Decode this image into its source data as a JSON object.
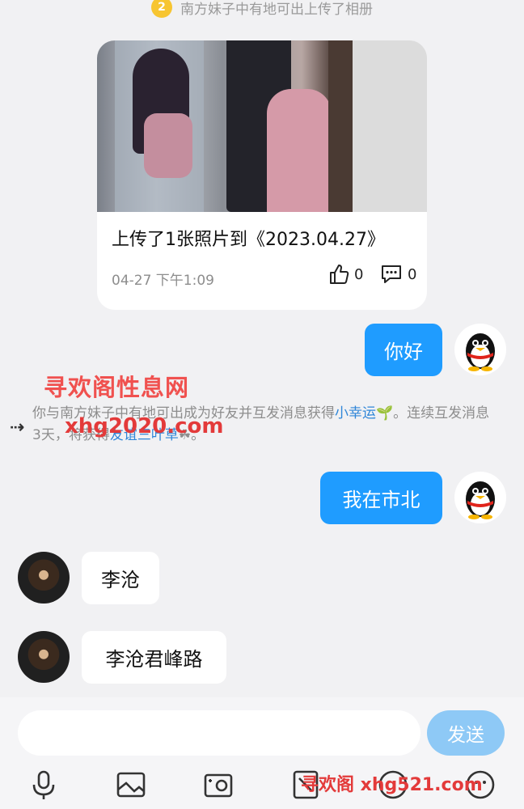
{
  "top_notice": {
    "text": "南方妹子中有地可出上传了相册",
    "badge": "2"
  },
  "feed_card": {
    "title": "上传了1张照片到《2023.04.27》",
    "time": "04-27 下午1:09",
    "likes": "0",
    "comments": "0"
  },
  "messages": [
    {
      "side": "out",
      "text": "你好"
    },
    {
      "side": "out",
      "text": "我在市北"
    },
    {
      "side": "in",
      "text": "李沧"
    },
    {
      "side": "in",
      "text": "李沧君峰路"
    }
  ],
  "system_notice": {
    "part1": "你与南方妹子中有地可出成为好友并互发消息获得",
    "link1": "小幸运",
    "emoji1": "🌱",
    "part2": "。连续互发消息3天，将获得",
    "link2": "友谊三叶草",
    "emoji2": "☘",
    "part3": "。"
  },
  "watermarks": {
    "top": "寻欢阁性息网",
    "url": "xhg2020.com",
    "bottom": "寻欢阁 xhg521.com"
  },
  "input": {
    "placeholder": "",
    "send_label": "发送"
  },
  "colors": {
    "accent": "#1f9cff",
    "send_disabled": "#8ec9f6",
    "link": "#2f86d8"
  }
}
